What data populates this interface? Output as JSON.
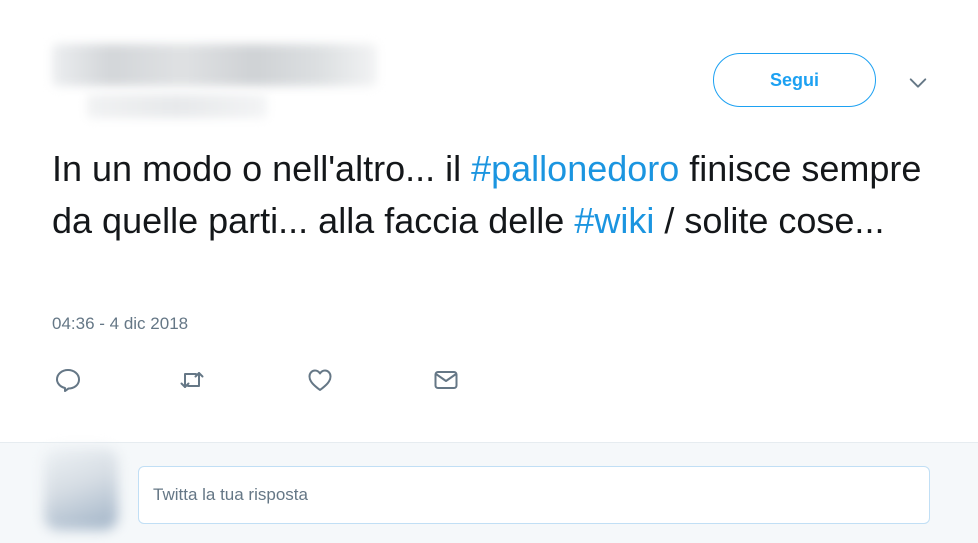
{
  "header": {
    "follow_label": "Segui"
  },
  "tweet": {
    "segments": [
      {
        "text": "In un modo o nell'altro... il ",
        "hashtag": false
      },
      {
        "text": "#pallonedoro",
        "hashtag": true
      },
      {
        "text": " finisce sempre da quelle parti... alla faccia delle ",
        "hashtag": false
      },
      {
        "text": "#wiki",
        "hashtag": true
      },
      {
        "text": " / solite cose...",
        "hashtag": false
      }
    ],
    "timestamp": "04:36 - 4 dic 2018"
  },
  "actions": [
    {
      "name": "reply-icon"
    },
    {
      "name": "retweet-icon"
    },
    {
      "name": "like-icon"
    },
    {
      "name": "direct-message-icon"
    }
  ],
  "reply": {
    "placeholder": "Twitta la tua risposta"
  },
  "colors": {
    "accent": "#1da1f2",
    "hashtag": "#1b95e0",
    "text": "#14171a",
    "muted": "#657786"
  }
}
